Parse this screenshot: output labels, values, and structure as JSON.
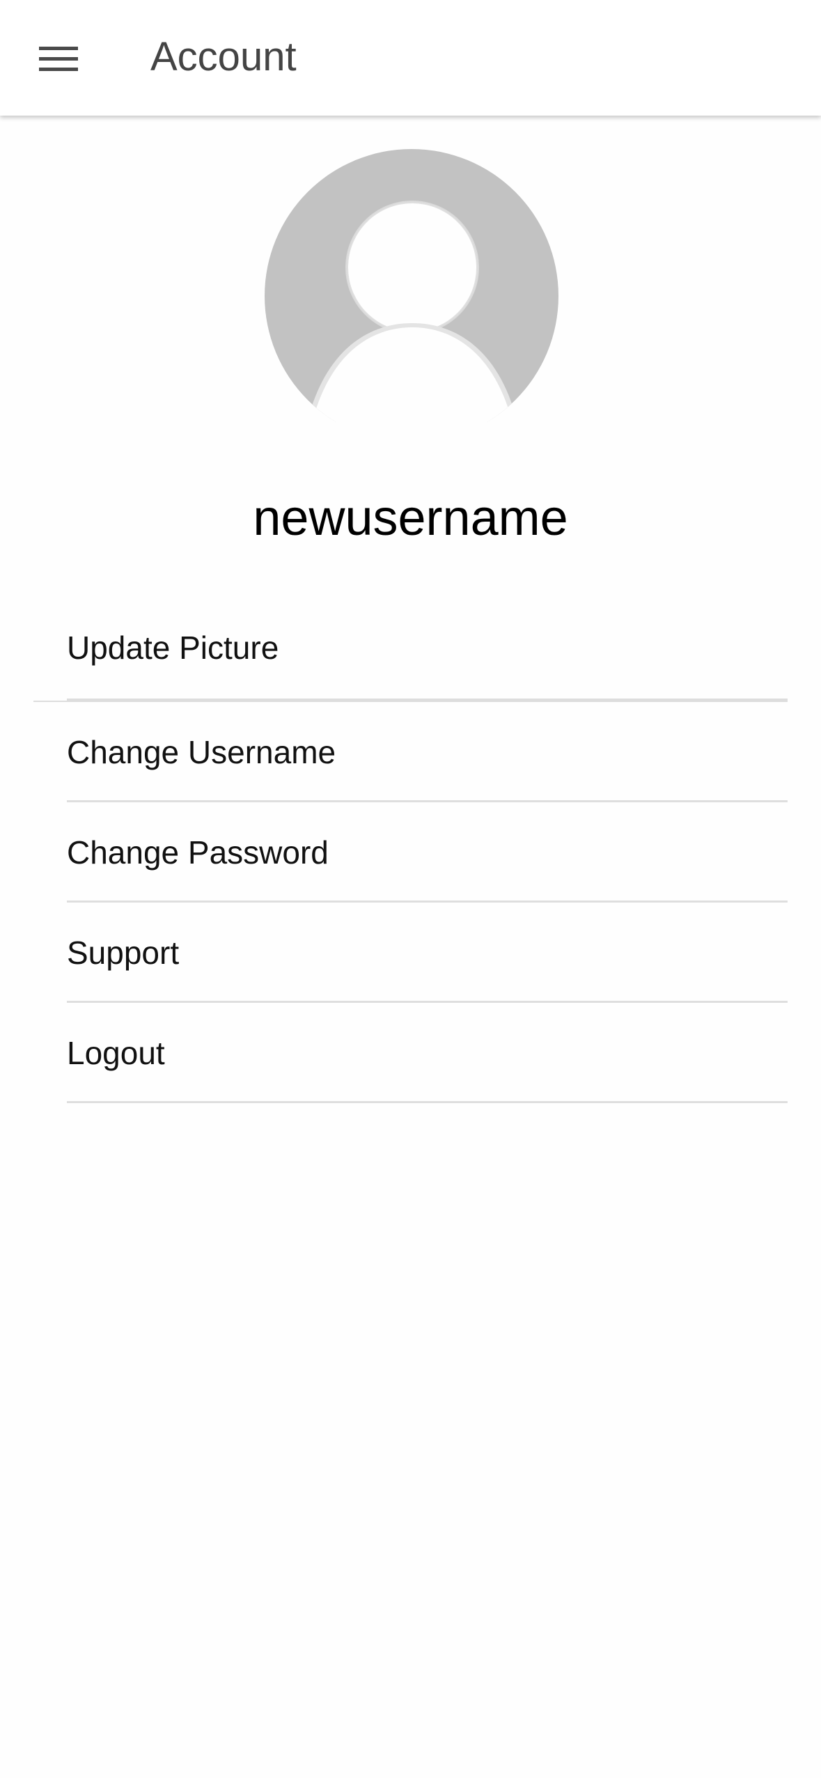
{
  "header": {
    "title": "Account",
    "menu_icon": "hamburger-menu-icon"
  },
  "profile": {
    "avatar_icon": "default-user-avatar-icon",
    "avatar_color": "#c2c2c2",
    "username": "newusername"
  },
  "menu": {
    "items": [
      {
        "label": "Update Picture"
      },
      {
        "label": "Change Username"
      },
      {
        "label": "Change Password"
      },
      {
        "label": "Support"
      },
      {
        "label": "Logout"
      }
    ]
  }
}
